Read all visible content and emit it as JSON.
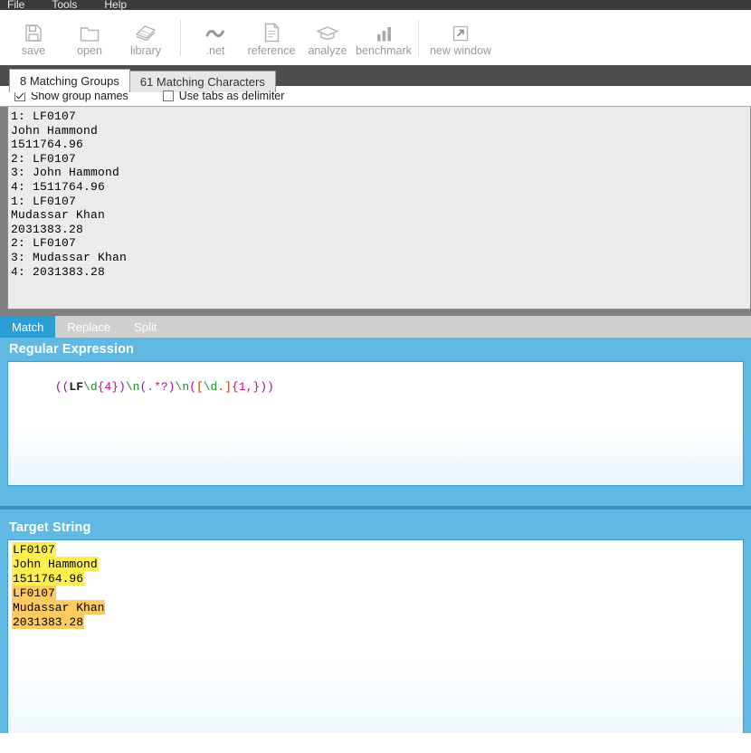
{
  "menubar": {
    "items": [
      {
        "label": "File"
      },
      {
        "label": "Tools"
      },
      {
        "label": "Help"
      }
    ]
  },
  "toolbar": {
    "groups": [
      {
        "tools": [
          {
            "label": "save",
            "icon": "floppy-disk-icon"
          },
          {
            "label": "open",
            "icon": "folder-icon"
          },
          {
            "label": "library",
            "icon": "books-icon"
          }
        ]
      },
      {
        "tools": [
          {
            "label": ".net",
            "icon": "tilde-icon"
          },
          {
            "label": "reference",
            "icon": "document-icon"
          },
          {
            "label": "analyze",
            "icon": "graduation-cap-icon"
          },
          {
            "label": "benchmark",
            "icon": "bar-chart-icon"
          }
        ]
      },
      {
        "tools": [
          {
            "label": "new window",
            "icon": "external-link-icon"
          }
        ]
      }
    ]
  },
  "results": {
    "tabs": [
      {
        "label": "8 Matching Groups",
        "active": true
      },
      {
        "label": "61 Matching Characters",
        "active": false
      }
    ],
    "options": [
      {
        "label": "Show group names",
        "checked": true
      },
      {
        "label": "Use tabs as delimiter",
        "checked": false
      }
    ],
    "lines": [
      "1: LF0107",
      "John Hammond",
      "1511764.96",
      "2: LF0107",
      "3: John Hammond",
      "4: 1511764.96",
      "1: LF0107",
      "Mudassar Khan",
      "2031383.28",
      "2: LF0107",
      "3: Mudassar Khan",
      "4: 2031383.28"
    ]
  },
  "modes": {
    "tabs": [
      {
        "label": "Match",
        "active": true
      },
      {
        "label": "Replace",
        "active": false
      },
      {
        "label": "Split",
        "active": false
      }
    ]
  },
  "regex": {
    "title": "Regular Expression",
    "value": "((LF\\d{4})\\n(.*?)\\n([\\d.]{1,}))",
    "tokens": [
      {
        "text": "((",
        "type": "paren"
      },
      {
        "text": "LF",
        "type": "lit"
      },
      {
        "text": "\\d",
        "type": "esc"
      },
      {
        "text": "{4}",
        "type": "quant"
      },
      {
        "text": ")",
        "type": "paren"
      },
      {
        "text": "\\n",
        "type": "esc"
      },
      {
        "text": "(",
        "type": "paren"
      },
      {
        "text": ".",
        "type": "meta"
      },
      {
        "text": "*?",
        "type": "quant"
      },
      {
        "text": ")",
        "type": "paren"
      },
      {
        "text": "\\n",
        "type": "esc"
      },
      {
        "text": "(",
        "type": "paren"
      },
      {
        "text": "[",
        "type": "class"
      },
      {
        "text": "\\d",
        "type": "esc"
      },
      {
        "text": ".",
        "type": "class"
      },
      {
        "text": "]",
        "type": "class"
      },
      {
        "text": "{1,}",
        "type": "quant"
      },
      {
        "text": "))",
        "type": "paren"
      }
    ]
  },
  "target": {
    "title": "Target String",
    "lines": [
      {
        "text": "LF0107",
        "highlight": "#ffef4d"
      },
      {
        "text": "John Hammond",
        "highlight": "#ffef4d"
      },
      {
        "text": "1511764.96",
        "highlight": "#ffef4d"
      },
      {
        "text": "LF0107",
        "highlight": "#ffca5e"
      },
      {
        "text": "Mudassar Khan",
        "highlight": "#ffca5e"
      },
      {
        "text": "2031383.28",
        "highlight": "#ffca5e"
      }
    ]
  },
  "colors": {
    "accent_blue": "#5fb9e2",
    "tab_active_blue": "#2a9fd6",
    "dark_band": "#4d4d4d",
    "grey_band": "#808080",
    "highlight_primary": "#ffef4d",
    "highlight_secondary": "#ffca5e"
  }
}
